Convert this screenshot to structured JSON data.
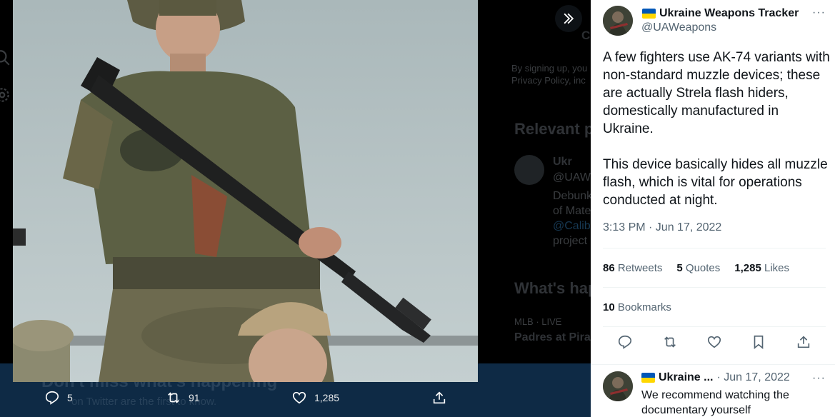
{
  "background": {
    "cta_title": "Don't miss what's happening",
    "cta_sub": "on Twitter are the first to know.",
    "signup_line1": "By signing up, you",
    "signup_line2": "Privacy Policy, inc",
    "relevant_heading": "Relevant p",
    "rel_name": "Ukr",
    "rel_handle": "@UAW",
    "rel_line1": "Debunk",
    "rel_line2": "of Mate",
    "rel_line3": "@Calib",
    "rel_line4": "project",
    "whats_heading": "What's hap",
    "mlb_live": "MLB · LIVE",
    "mlb_game": "Padres at Pira",
    "c_fragment": "C"
  },
  "media_actions": {
    "replies": "5",
    "retweets": "91",
    "likes": "1,285"
  },
  "tweet": {
    "author_name": "Ukraine Weapons Tracker",
    "author_handle": "@UAWeapons",
    "more_label": "···",
    "paragraph1": "A few fighters use AK-74 variants with non-standard muzzle devices; these are actually Strela flash hiders, domestically manufactured in Ukraine.",
    "paragraph2": "This device basically hides all muzzle flash, which is vital for operations conducted at night.",
    "time": "3:13 PM · Jun 17, 2022",
    "retweets_count": "86",
    "retweets_label": "Retweets",
    "quotes_count": "5",
    "quotes_label": "Quotes",
    "likes_count": "1,285",
    "likes_label": "Likes",
    "bookmarks_count": "10",
    "bookmarks_label": "Bookmarks"
  },
  "reply": {
    "author_name": "Ukraine ...",
    "date": "· Jun 17, 2022",
    "more_label": "···",
    "text": "We recommend watching the documentary yourself"
  },
  "colors": {
    "flag_blue": "#0057b7",
    "flag_yellow": "#ffd700",
    "accent": "#1d9bf0"
  }
}
